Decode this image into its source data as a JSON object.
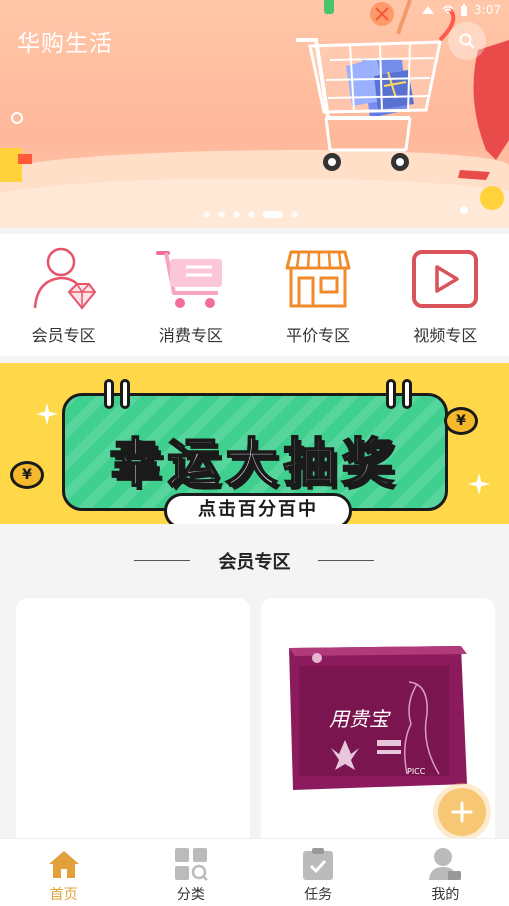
{
  "status_bar": {
    "time": "3:07"
  },
  "header": {
    "app_title": "华购生活"
  },
  "banner": {
    "slide_count": 6,
    "active_index": 4
  },
  "categories": [
    {
      "label": "会员专区",
      "icon": "member-gem-icon"
    },
    {
      "label": "消费专区",
      "icon": "shopping-cart-icon"
    },
    {
      "label": "平价专区",
      "icon": "storefront-icon"
    },
    {
      "label": "视频专区",
      "icon": "video-play-icon"
    }
  ],
  "lottery": {
    "headline": "幸运大抽奖",
    "subline": "点击百分百中",
    "coin_symbol": "¥"
  },
  "section": {
    "title": "会员专区"
  },
  "products": [
    {
      "name": ""
    },
    {
      "box_title": "用贵宝",
      "box_brand": "PICC"
    }
  ],
  "bottom_nav": [
    {
      "label": "首页",
      "icon": "home-icon",
      "active": true
    },
    {
      "label": "分类",
      "icon": "category-grid-icon",
      "active": false
    },
    {
      "label": "任务",
      "icon": "task-clipboard-icon",
      "active": false
    },
    {
      "label": "我的",
      "icon": "profile-icon",
      "active": false
    }
  ],
  "colors": {
    "accent": "#e2a13a",
    "hero_bg": "#ffb79a",
    "category_icon": "#e8546a",
    "lottery_bg": "#ffd84a",
    "lottery_board": "#3fcf8e",
    "fab": "#f7c774"
  }
}
